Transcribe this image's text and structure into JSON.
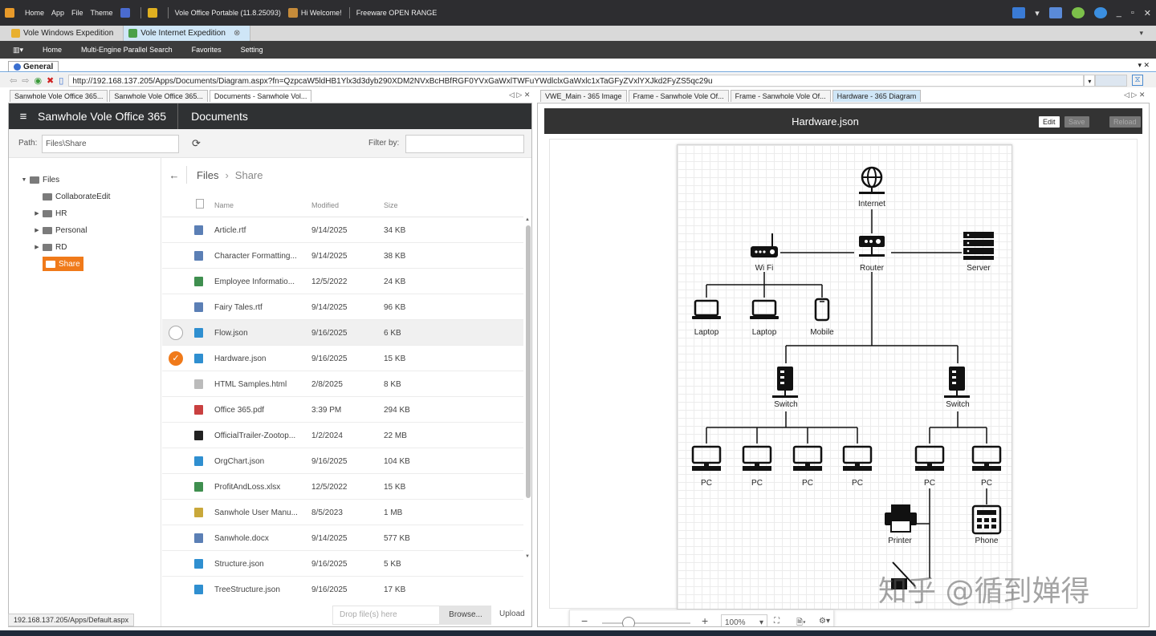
{
  "titlebar": {
    "items": [
      "Home",
      "App",
      "File",
      "Theme"
    ],
    "portable": "Vole Office Portable (11.8.25093)",
    "welcome": "Hi Welcome!",
    "range": "Freeware OPEN RANGE",
    "controls": [
      "_",
      "▫",
      "✕"
    ]
  },
  "window_tabs": [
    "Vole Windows Expedition",
    "Vole Internet Expedition"
  ],
  "menubar": [
    "Home",
    "Multi-Engine Parallel Search",
    "Favorites",
    "Setting"
  ],
  "general_tab": "General",
  "address": {
    "url": "http://192.168.137.205/Apps/Documents/Diagram.aspx?fn=QzpcaW5ldHB1Ylx3d3dyb290XDM2NVxBcHBfRGF0YVxGaWxlTWFuYWdlclxGaWxlc1xTaGFyZVxlYXJkd2FyZS5qc29u"
  },
  "left_tabs": [
    "Sanwhole Vole Office 365...",
    "Sanwhole Vole Office 365...",
    "Documents - Sanwhole Vol..."
  ],
  "right_tabs": [
    "VWE_Main - 365 Image",
    "Frame - Sanwhole Vole Of...",
    "Frame - Sanwhole Vole Of...",
    "Hardware - 365 Diagram"
  ],
  "docs": {
    "brand": "Sanwhole Vole Office 365",
    "section": "Documents",
    "path_label": "Path:",
    "path_value": "Files\\Share",
    "filter_label": "Filter by:",
    "tree": [
      {
        "label": "Files",
        "level": 0,
        "expander": "▼"
      },
      {
        "label": "CollaborateEdit",
        "level": 1,
        "expander": ""
      },
      {
        "label": "HR",
        "level": 1,
        "expander": "▶"
      },
      {
        "label": "Personal",
        "level": 1,
        "expander": "▶"
      },
      {
        "label": "RD",
        "level": 1,
        "expander": "▶"
      },
      {
        "label": "Share",
        "level": 1,
        "expander": "",
        "selected": true
      }
    ],
    "breadcrumb": [
      "Files",
      "Share"
    ],
    "columns": [
      "Name",
      "Modified",
      "Size"
    ],
    "files": [
      {
        "name": "Article.rtf",
        "modified": "9/14/2025",
        "size": "34 KB",
        "icon": "word-doc-icon",
        "color": "#5b7fb5"
      },
      {
        "name": "Character Formatting...",
        "modified": "9/14/2025",
        "size": "38 KB",
        "icon": "word-doc-icon",
        "color": "#5b7fb5"
      },
      {
        "name": "Employee Informatio...",
        "modified": "12/5/2022",
        "size": "24 KB",
        "icon": "excel-icon",
        "color": "#3f8f4f"
      },
      {
        "name": "Fairy Tales.rtf",
        "modified": "9/14/2025",
        "size": "96 KB",
        "icon": "word-doc-icon",
        "color": "#5b7fb5"
      },
      {
        "name": "Flow.json",
        "modified": "9/16/2025",
        "size": "6 KB",
        "icon": "diagram-json-icon",
        "color": "#2f8fd0",
        "hover": true
      },
      {
        "name": "Hardware.json",
        "modified": "9/16/2025",
        "size": "15 KB",
        "icon": "diagram-json-icon",
        "color": "#2f8fd0",
        "checked": true
      },
      {
        "name": "HTML Samples.html",
        "modified": "2/8/2025",
        "size": "8 KB",
        "icon": "blank-file-icon",
        "color": "#bbbbbb"
      },
      {
        "name": "Office 365.pdf",
        "modified": "3:39 PM",
        "size": "294 KB",
        "icon": "pdf-icon",
        "color": "#c94040"
      },
      {
        "name": "OfficialTrailer-Zootop...",
        "modified": "1/2/2024",
        "size": "22 MB",
        "icon": "video-icon",
        "color": "#222222"
      },
      {
        "name": "OrgChart.json",
        "modified": "9/16/2025",
        "size": "104 KB",
        "icon": "diagram-json-icon",
        "color": "#2f8fd0"
      },
      {
        "name": "ProfitAndLoss.xlsx",
        "modified": "12/5/2022",
        "size": "15 KB",
        "icon": "excel-icon",
        "color": "#3f8f4f"
      },
      {
        "name": "Sanwhole User Manu...",
        "modified": "8/5/2023",
        "size": "1 MB",
        "icon": "zip-icon",
        "color": "#c9a83a"
      },
      {
        "name": "Sanwhole.docx",
        "modified": "9/14/2025",
        "size": "577 KB",
        "icon": "word-doc-icon",
        "color": "#5b7fb5"
      },
      {
        "name": "Structure.json",
        "modified": "9/16/2025",
        "size": "5 KB",
        "icon": "diagram-json-icon",
        "color": "#2f8fd0"
      },
      {
        "name": "TreeStructure.json",
        "modified": "9/16/2025",
        "size": "17 KB",
        "icon": "diagram-json-icon",
        "color": "#2f8fd0"
      }
    ],
    "drop_placeholder": "Drop file(s) here",
    "browse": "Browse...",
    "upload": "Upload",
    "status_url": "192.168.137.205/Apps/Default.aspx"
  },
  "diagram": {
    "title": "Hardware.json",
    "edit": "Edit",
    "save": "Save",
    "reload": "Reload",
    "labels": {
      "internet": "Internet",
      "wifi": "Wi Fi",
      "router": "Router",
      "server": "Server",
      "laptop1": "Laptop",
      "laptop2": "Laptop",
      "mobile": "Mobile",
      "switch1": "Switch",
      "switch2": "Switch",
      "pc1": "PC",
      "pc2": "PC",
      "pc3": "PC",
      "pc4": "PC",
      "pc5": "PC",
      "pc6": "PC",
      "printer": "Printer",
      "phone": "Phone"
    },
    "zoom": "100%",
    "zoom_level": 0.3
  },
  "watermark": "知乎 @循到婵得"
}
